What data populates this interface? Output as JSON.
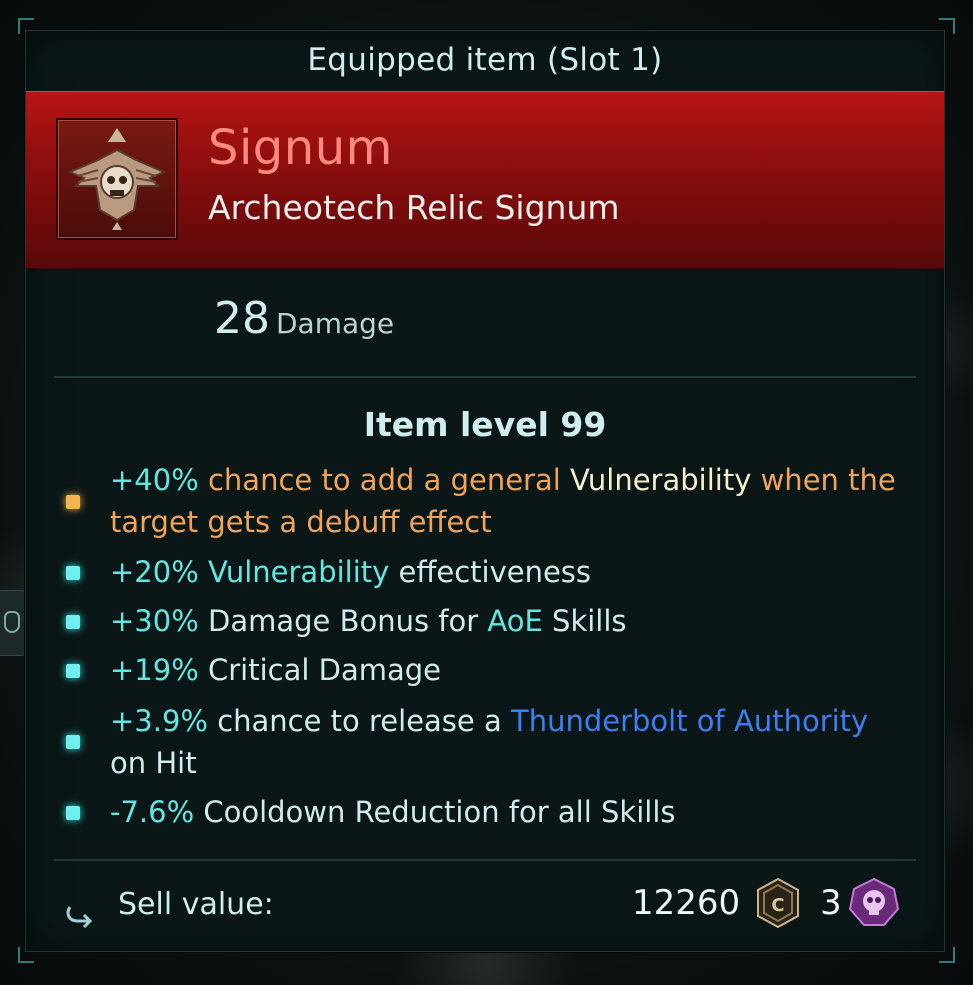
{
  "panel": {
    "title": "Equipped item (Slot 1)"
  },
  "item": {
    "name": "Signum",
    "type": "Archeotech Relic Signum",
    "icon": "skull-eagle-signum-icon",
    "damage_value": "28",
    "damage_label": "Damage",
    "level_text": "Item level 99"
  },
  "affixes": [
    {
      "bullet": "orange",
      "parts": [
        "+40%",
        " chance to add a general ",
        "Vulnerability",
        " when the target gets a debuff effect"
      ]
    },
    {
      "bullet": "cyan",
      "parts": [
        "+20%",
        " Vulnerability",
        " effectiveness"
      ]
    },
    {
      "bullet": "cyan",
      "parts": [
        "+30%",
        " Damage Bonus for ",
        "AoE",
        " Skills"
      ]
    },
    {
      "bullet": "cyan",
      "parts": [
        "+19%",
        " Critical Damage"
      ]
    },
    {
      "bullet": "cyan",
      "parts": [
        "+3.9%",
        " chance to release a ",
        "Thunderbolt of Authority",
        " on Hit"
      ]
    },
    {
      "bullet": "cyan",
      "parts": [
        "-7.6%",
        " Cooldown Reduction for all Skills"
      ]
    }
  ],
  "footer": {
    "sell_label": "Sell value:",
    "credits": "12260",
    "skulls": "3"
  },
  "colors": {
    "accent_cyan": "#63e6e2",
    "accent_orange": "#f0a45a",
    "link_blue": "#3f7df2",
    "banner_red": "#b81515"
  }
}
